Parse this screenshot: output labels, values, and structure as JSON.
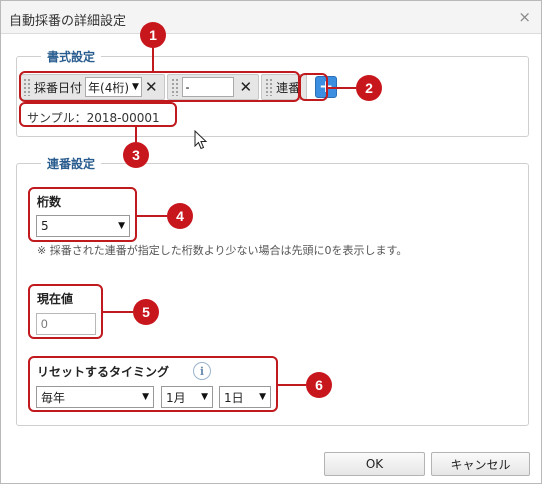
{
  "dialog": {
    "title": "自動採番の詳細設定",
    "close_glyph": "×"
  },
  "format_section": {
    "legend": "書式設定",
    "tokens": [
      {
        "label": "採番日付",
        "select_value": "年(4桁)"
      },
      {
        "label": "",
        "input_value": "-"
      },
      {
        "label": "連番"
      }
    ],
    "remove_glyph": "✕",
    "add_glyph": "+",
    "sample": "サンプル：2018-00001"
  },
  "serial_section": {
    "legend": "連番設定",
    "digits": {
      "label": "桁数",
      "value": "5"
    },
    "note": "※ 採番された連番が指定した桁数より少ない場合は先頭に0を表示します。",
    "current": {
      "label": "現在値",
      "placeholder": "0"
    },
    "reset": {
      "label": "リセットするタイミング",
      "info_glyph": "i",
      "period": "毎年",
      "month": "1月",
      "day": "1日"
    }
  },
  "footer": {
    "ok_label": "OK",
    "cancel_label": "キャンセル"
  },
  "callouts": [
    "1",
    "2",
    "3",
    "4",
    "5",
    "6"
  ],
  "colors": {
    "accent": "#c0191e",
    "legend": "#2a5d8f",
    "plus_button": "#3b8ee0"
  }
}
